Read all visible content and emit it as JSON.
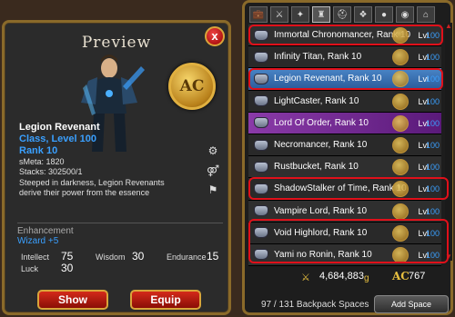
{
  "preview": {
    "title": "Preview",
    "close_label": "x",
    "ac_coin_label": "AC",
    "item": {
      "name": "Legion Revenant",
      "class_line": "Class, Level 100",
      "rank": "Rank 10",
      "smeta": "sMeta: 1820",
      "stacks": "Stacks: 302500/1",
      "description": "Steeped in darkness, Legion Revenants derive their power from the essence responsible for the Legion's"
    },
    "enhancement": {
      "title": "Enhancement",
      "value": "Wizard +5",
      "stats": {
        "intellect_label": "Intellect",
        "intellect": "75",
        "wisdom_label": "Wisdom",
        "wisdom": "30",
        "endurance_label": "Endurance",
        "endurance": "15",
        "luck_label": "Luck",
        "luck": "30"
      }
    },
    "show_button": "Show",
    "equip_button": "Equip",
    "side_icons": [
      "rank-icon",
      "gender-icon",
      "equip-slot-icon"
    ]
  },
  "inventory": {
    "tabs": [
      "bag-icon",
      "sword-icon",
      "wand-icon",
      "armor-icon",
      "helm-icon",
      "cape-icon",
      "pet-icon",
      "item-icon",
      "house-icon"
    ],
    "items": [
      {
        "name": "Immortal Chronomancer, Rank 10",
        "lvl_label": "Lvl",
        "lvl": "100",
        "state": "normal"
      },
      {
        "name": "Infinity Titan, Rank 10",
        "lvl_label": "Lvl",
        "lvl": "100",
        "state": "normal"
      },
      {
        "name": "Legion Revenant, Rank 10",
        "lvl_label": "Lvl",
        "lvl": "100",
        "state": "selected"
      },
      {
        "name": "LightCaster, Rank 10",
        "lvl_label": "Lvl",
        "lvl": "100",
        "state": "normal"
      },
      {
        "name": "Lord Of Order, Rank 10",
        "lvl_label": "Lvl",
        "lvl": "100",
        "state": "purple"
      },
      {
        "name": "Necromancer, Rank 10",
        "lvl_label": "Lvl",
        "lvl": "100",
        "state": "normal"
      },
      {
        "name": "Rustbucket, Rank 10",
        "lvl_label": "Lvl",
        "lvl": "100",
        "state": "normal"
      },
      {
        "name": "ShadowStalker of Time, Rank 10",
        "lvl_label": "Lvl",
        "lvl": "100",
        "state": "normal"
      },
      {
        "name": "Vampire Lord, Rank 10",
        "lvl_label": "Lvl",
        "lvl": "100",
        "state": "normal"
      },
      {
        "name": "Void Highlord, Rank 10",
        "lvl_label": "Lvl",
        "lvl": "100",
        "state": "normal"
      },
      {
        "name": "Yami no Ronin, Rank 10",
        "lvl_label": "Lvl",
        "lvl": "100",
        "state": "normal"
      }
    ],
    "gold": "4,684,883",
    "gold_unit": "g",
    "ac_label": "AC",
    "ac": "767",
    "backpack": "97 / 131 Backpack Spaces",
    "add_space": "Add Space"
  },
  "colors": {
    "frame_gold": "#8a6a2a",
    "highlight_red": "#e0101a",
    "blue_text": "#3aa0ff",
    "selected_row": "#4a86c8",
    "purple_row": "#8a3aa8"
  }
}
